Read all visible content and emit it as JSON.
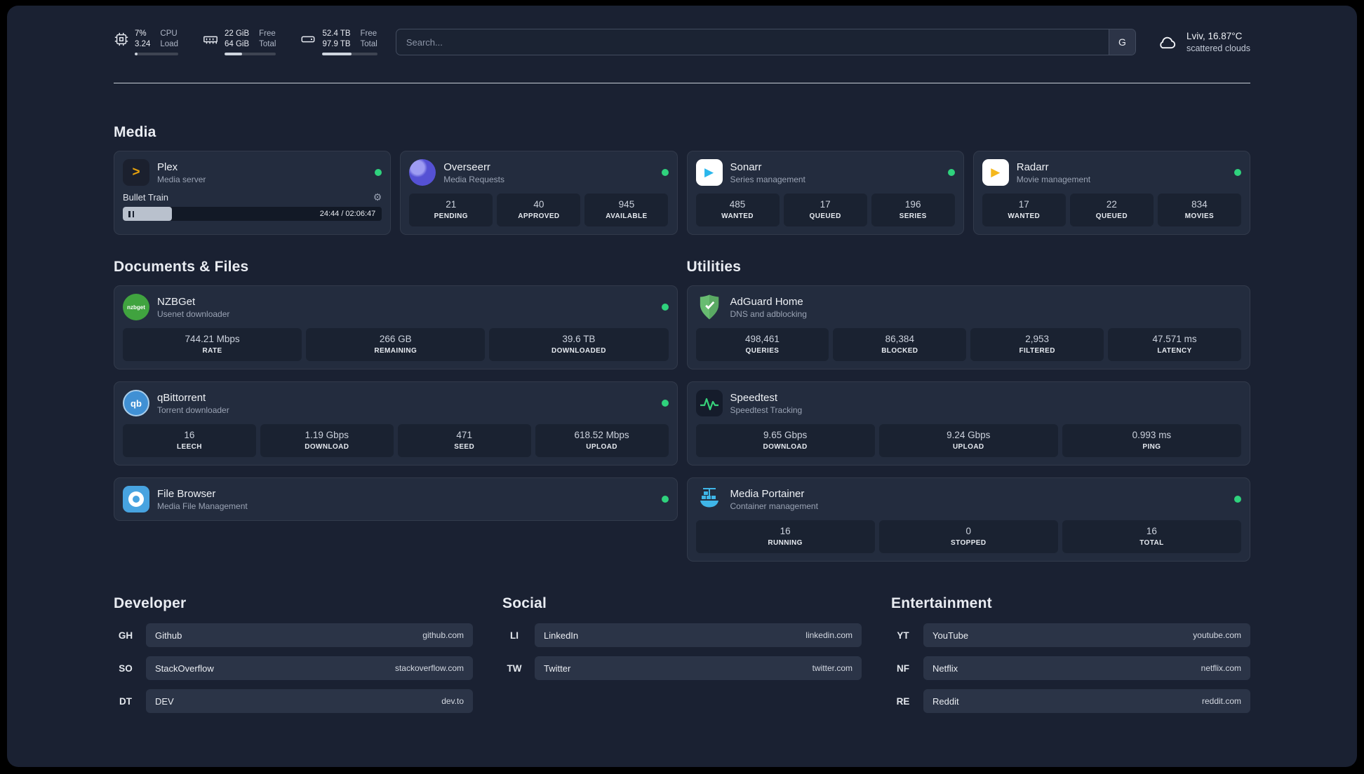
{
  "topbar": {
    "cpu": {
      "value_top": "7%",
      "value_bottom": "3.24",
      "label_top": "CPU",
      "label_bottom": "Load",
      "progress": 7
    },
    "ram": {
      "value_top": "22 GiB",
      "value_bottom": "64 GiB",
      "label_top": "Free",
      "label_bottom": "Total",
      "progress": 34
    },
    "disk": {
      "value_top": "52.4 TB",
      "value_bottom": "97.9 TB",
      "label_top": "Free",
      "label_bottom": "Total",
      "progress": 53
    },
    "search": {
      "placeholder": "Search...",
      "engine_label": "G"
    },
    "weather": {
      "location": "Lviv, 16.87°C",
      "condition": "scattered clouds"
    }
  },
  "icons": {
    "gear": "⚙",
    "plex_glyph": ">",
    "sonarr_glyph": "▶",
    "radarr_glyph": "▶",
    "nzbget_glyph": "nzbget",
    "qbittorrent_glyph": "qb"
  },
  "colors": {
    "status_online": "#2fd27d",
    "plex": "#e5a00d",
    "overseerr": "#5551d4",
    "sonarr": "#2bb7ec",
    "radarr": "#f5b81c",
    "nzbget": "#40a33f",
    "qbittorrent": "#4090d4",
    "filebrowser": "#47a3e0",
    "adguard": "#68bc71",
    "speedtest": "#37d27a",
    "portainer": "#3fb6e8"
  },
  "sections": {
    "media": {
      "title": "Media",
      "apps": [
        {
          "name": "Plex",
          "subtitle": "Media server",
          "online": true,
          "now_playing": {
            "title": "Bullet Train",
            "time": "24:44 / 02:06:47",
            "progress": 19
          }
        },
        {
          "name": "Overseerr",
          "subtitle": "Media Requests",
          "online": true,
          "stats": [
            {
              "value": "21",
              "label": "PENDING"
            },
            {
              "value": "40",
              "label": "APPROVED"
            },
            {
              "value": "945",
              "label": "AVAILABLE"
            }
          ]
        },
        {
          "name": "Sonarr",
          "subtitle": "Series management",
          "online": true,
          "stats": [
            {
              "value": "485",
              "label": "WANTED"
            },
            {
              "value": "17",
              "label": "QUEUED"
            },
            {
              "value": "196",
              "label": "SERIES"
            }
          ]
        },
        {
          "name": "Radarr",
          "subtitle": "Movie management",
          "online": true,
          "stats": [
            {
              "value": "17",
              "label": "WANTED"
            },
            {
              "value": "22",
              "label": "QUEUED"
            },
            {
              "value": "834",
              "label": "MOVIES"
            }
          ]
        }
      ]
    },
    "documents": {
      "title": "Documents & Files",
      "apps": [
        {
          "name": "NZBGet",
          "subtitle": "Usenet downloader",
          "online": true,
          "stats": [
            {
              "value": "744.21 Mbps",
              "label": "RATE"
            },
            {
              "value": "266 GB",
              "label": "REMAINING"
            },
            {
              "value": "39.6 TB",
              "label": "DOWNLOADED"
            }
          ]
        },
        {
          "name": "qBittorrent",
          "subtitle": "Torrent downloader",
          "online": true,
          "stats": [
            {
              "value": "16",
              "label": "LEECH"
            },
            {
              "value": "1.19 Gbps",
              "label": "DOWNLOAD"
            },
            {
              "value": "471",
              "label": "SEED"
            },
            {
              "value": "618.52 Mbps",
              "label": "UPLOAD"
            }
          ]
        },
        {
          "name": "File Browser",
          "subtitle": "Media File Management",
          "online": true,
          "stats": []
        }
      ]
    },
    "utilities": {
      "title": "Utilities",
      "apps": [
        {
          "name": "AdGuard Home",
          "subtitle": "DNS and adblocking",
          "stats": [
            {
              "value": "498,461",
              "label": "QUERIES"
            },
            {
              "value": "86,384",
              "label": "BLOCKED"
            },
            {
              "value": "2,953",
              "label": "FILTERED"
            },
            {
              "value": "47.571 ms",
              "label": "LATENCY"
            }
          ]
        },
        {
          "name": "Speedtest",
          "subtitle": "Speedtest Tracking",
          "stats": [
            {
              "value": "9.65 Gbps",
              "label": "DOWNLOAD"
            },
            {
              "value": "9.24 Gbps",
              "label": "UPLOAD"
            },
            {
              "value": "0.993 ms",
              "label": "PING"
            }
          ]
        },
        {
          "name": "Media Portainer",
          "subtitle": "Container management",
          "online": true,
          "stats": [
            {
              "value": "16",
              "label": "RUNNING"
            },
            {
              "value": "0",
              "label": "STOPPED"
            },
            {
              "value": "16",
              "label": "TOTAL"
            }
          ]
        }
      ]
    },
    "bookmarks": [
      {
        "title": "Developer",
        "items": [
          {
            "abbr": "GH",
            "name": "Github",
            "url": "github.com"
          },
          {
            "abbr": "SO",
            "name": "StackOverflow",
            "url": "stackoverflow.com"
          },
          {
            "abbr": "DT",
            "name": "DEV",
            "url": "dev.to"
          }
        ]
      },
      {
        "title": "Social",
        "items": [
          {
            "abbr": "LI",
            "name": "LinkedIn",
            "url": "linkedin.com"
          },
          {
            "abbr": "TW",
            "name": "Twitter",
            "url": "twitter.com"
          }
        ]
      },
      {
        "title": "Entertainment",
        "items": [
          {
            "abbr": "YT",
            "name": "YouTube",
            "url": "youtube.com"
          },
          {
            "abbr": "NF",
            "name": "Netflix",
            "url": "netflix.com"
          },
          {
            "abbr": "RE",
            "name": "Reddit",
            "url": "reddit.com"
          }
        ]
      }
    ]
  }
}
